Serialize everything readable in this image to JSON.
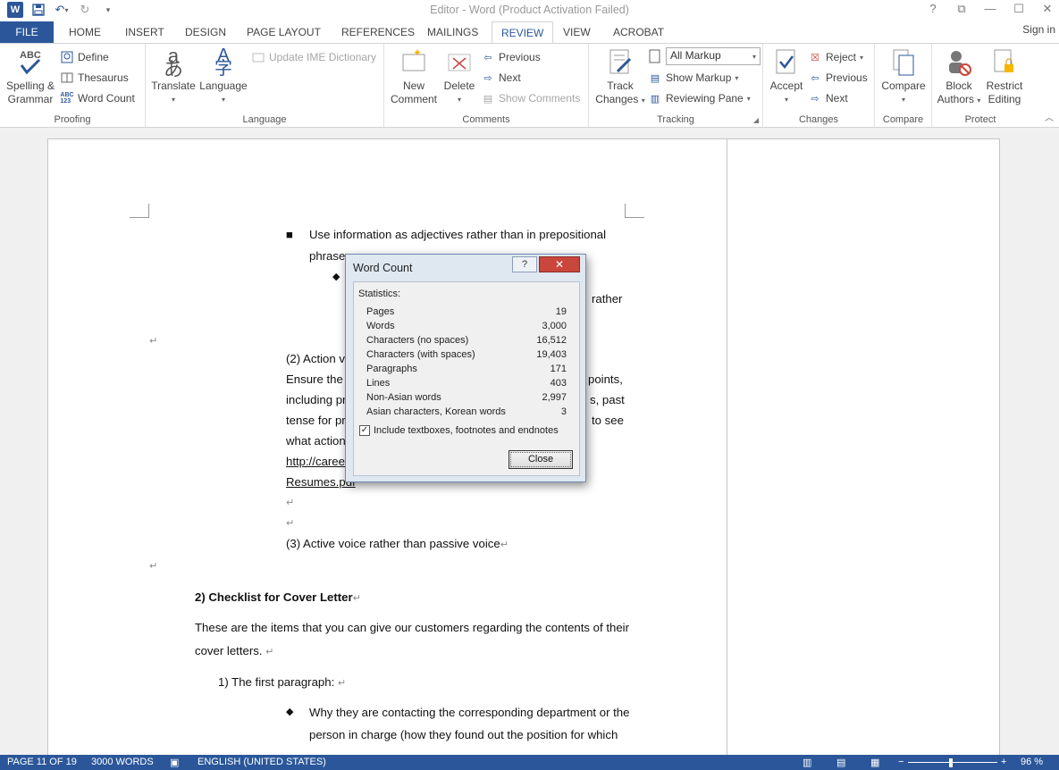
{
  "window": {
    "title": "Editor - Word (Product Activation Failed)",
    "controls": [
      "?",
      "⧉",
      "—",
      "☐",
      "✕"
    ]
  },
  "qat": {
    "icons": [
      "word-logo",
      "save-icon",
      "undo-icon",
      "redo-icon",
      "customize-icon"
    ]
  },
  "tabs": [
    "FILE",
    "HOME",
    "INSERT",
    "DESIGN",
    "PAGE LAYOUT",
    "REFERENCES",
    "MAILINGS",
    "REVIEW",
    "VIEW",
    "ACROBAT"
  ],
  "active_tab": "REVIEW",
  "signin": "Sign in",
  "ribbon": {
    "proofing": {
      "label": "Proofing",
      "spelling": [
        "Spelling &",
        "Grammar"
      ],
      "abc": "ABC",
      "define": "Define",
      "thesaurus": "Thesaurus",
      "word_count": "Word Count"
    },
    "language": {
      "label": "Language",
      "translate": "Translate",
      "language": "Language",
      "update_ime": "Update IME Dictionary"
    },
    "comments": {
      "label": "Comments",
      "new_comment": [
        "New",
        "Comment"
      ],
      "delete": "Delete",
      "previous": "Previous",
      "next": "Next",
      "show_comments": "Show Comments"
    },
    "tracking": {
      "label": "Tracking",
      "track_changes": [
        "Track",
        "Changes"
      ],
      "all_markup": "All Markup",
      "show_markup": "Show Markup",
      "reviewing_pane": "Reviewing Pane"
    },
    "changes": {
      "label": "Changes",
      "accept": "Accept",
      "reject": "Reject",
      "previous": "Previous",
      "next": "Next"
    },
    "compare": {
      "label": "Compare",
      "compare": "Compare"
    },
    "protect": {
      "label": "Protect",
      "block_authors": [
        "Block",
        "Authors"
      ],
      "restrict_editing": [
        "Restrict",
        "Editing"
      ]
    }
  },
  "document": {
    "bullet1_l1": "Use information as adjectives rather than in prepositional",
    "bullet1_l2": "phrases",
    "rather": "rather",
    "action_voice": "(2) Action vo",
    "ensure": "Ensure  the",
    "points": "points,",
    "including": "including  pr",
    "s_past": "s,  past",
    "tense": "tense  for  pr",
    "to_see": "to  see",
    "what_action": "what action",
    "link1": "http://caree",
    "link2": "Resumes.pdf",
    "active_voice": "(3) Active voice rather than passive voice",
    "checklist": "2) Checklist for Cover Letter",
    "these_l1": "These are the items that you can give our customers regarding the contents of their",
    "these_l2": "cover letters.",
    "first_para": "1) The first paragraph:",
    "why_l1": "Why they are contacting the corresponding department or the",
    "why_l2": "person in charge (how they found out the position for which",
    "para_mark": "↵"
  },
  "dialog": {
    "title": "Word Count",
    "help": "?",
    "close_x": "✕",
    "statistics_label": "Statistics:",
    "stats": [
      {
        "label": "Pages",
        "value": "19"
      },
      {
        "label": "Words",
        "value": "3,000"
      },
      {
        "label": "Characters (no spaces)",
        "value": "16,512"
      },
      {
        "label": "Characters (with spaces)",
        "value": "19,403"
      },
      {
        "label": "Paragraphs",
        "value": "171"
      },
      {
        "label": "Lines",
        "value": "403"
      },
      {
        "label": "Non-Asian words",
        "value": "2,997"
      },
      {
        "label": "Asian characters, Korean words",
        "value": "3"
      }
    ],
    "include_checkbox": "Include textboxes, footnotes and endnotes",
    "include_checked": true,
    "close_button": "Close"
  },
  "status": {
    "page": "PAGE 11 OF 19",
    "words": "3000 WORDS",
    "language": "ENGLISH (UNITED STATES)",
    "zoom": "96 %",
    "zoom_minus": "−",
    "zoom_plus": "+"
  },
  "colors": {
    "accent": "#2b579a",
    "dialog_close": "#c9463d"
  }
}
